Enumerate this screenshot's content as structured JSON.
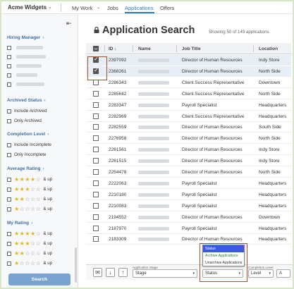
{
  "nav": {
    "brand": "Acme Widgets",
    "items": [
      "My Work",
      "Jobs",
      "Applications",
      "Offers"
    ],
    "active": "Applications"
  },
  "sidebar": {
    "sections": {
      "hiring_manager": "Hiring Manager",
      "archived_status": "Archived Status",
      "completion_level": "Completion Level",
      "average_rating": "Average Rating",
      "my_rating": "My Rating"
    },
    "archived_options": [
      "Include Archived",
      "Only Archived"
    ],
    "completion_options": [
      "Include Incomplete",
      "Only Incomplete"
    ],
    "and_up": "& up",
    "search_button": "Search"
  },
  "main": {
    "title": "Application Search",
    "showing": "Showing 50 of 149 applications",
    "columns": {
      "id": "ID",
      "name": "Name",
      "job": "Job Title",
      "location": "Location"
    },
    "rows": [
      {
        "id": "2397092",
        "job": "Director of Human Resources",
        "location": "Indy Store",
        "selected": true
      },
      {
        "id": "2368261",
        "job": "Director of Human Resources",
        "location": "North Side",
        "selected": true
      },
      {
        "id": "2286343",
        "job": "Client Success Representative",
        "location": "Downtown",
        "selected": false
      },
      {
        "id": "2285642",
        "job": "Client Success Representative",
        "location": "North Side",
        "selected": false
      },
      {
        "id": "2283347",
        "job": "Payroll Specialist",
        "location": "Headquarters",
        "selected": false
      },
      {
        "id": "2282969",
        "job": "Client Success Representative",
        "location": "Headquarters",
        "selected": false
      },
      {
        "id": "2282559",
        "job": "Director of Human Resources",
        "location": "South Side",
        "selected": false
      },
      {
        "id": "2276958",
        "job": "Director of Human Resources",
        "location": "North Side",
        "selected": false
      },
      {
        "id": "2261561",
        "job": "Director of Human Resources",
        "location": "Indy Store",
        "selected": false
      },
      {
        "id": "2261515",
        "job": "Director of Human Resources",
        "location": "Indy Store",
        "selected": false
      },
      {
        "id": "2254478",
        "job": "Director of Human Resources",
        "location": "North Side",
        "selected": false
      },
      {
        "id": "2222063",
        "job": "Payroll Specialist",
        "location": "Headquarters",
        "selected": false
      },
      {
        "id": "2210180",
        "job": "Payroll Specialist",
        "location": "Headquarters",
        "selected": false
      },
      {
        "id": "2210083",
        "job": "Payroll Specialist",
        "location": "Headquarters",
        "selected": false
      },
      {
        "id": "2194552",
        "job": "Director of Human Resources",
        "location": "Downtown",
        "selected": false
      },
      {
        "id": "2187970",
        "job": "Payroll Specialist",
        "location": "Headquarters",
        "selected": false
      },
      {
        "id": "2183309",
        "job": "Director of Human Resources",
        "location": "Headquarters",
        "selected": false
      }
    ]
  },
  "toolbar": {
    "stage_caption": "Application Stage",
    "stage_value": "Stage",
    "status_value": "Status",
    "level_caption": "Completion Level",
    "level_value": "Level",
    "extra_value": "A"
  },
  "status_menu": {
    "options": [
      "Status",
      "Archive Applications",
      "Unarchive Applications"
    ]
  },
  "colors": {
    "accent": "#2c7bbf",
    "star": "#e3b31a",
    "highlight_outline": "#a0522d"
  }
}
